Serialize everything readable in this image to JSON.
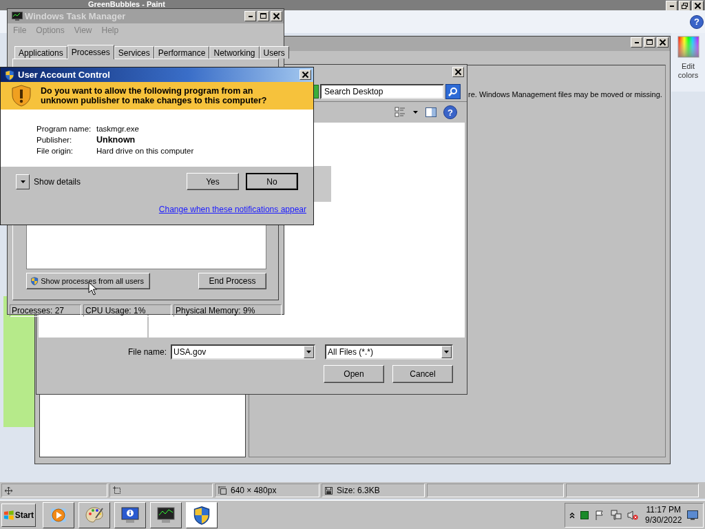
{
  "paint": {
    "title": "GreenBubbles - Paint",
    "help": "?",
    "edit_colors": "Edit colors",
    "status_cells": [
      {
        "kind": "move"
      },
      {
        "kind": "selection"
      },
      {
        "kind": "dimensions",
        "text": "640 × 480px"
      },
      {
        "kind": "size",
        "text": "Size: 6.3KB"
      },
      {
        "kind": "empty"
      },
      {
        "kind": "empty"
      }
    ]
  },
  "error_window": {
    "message": "re. Windows Management files may be moved or missing."
  },
  "open_dialog": {
    "search": {
      "placeholder": "Search Desktop"
    },
    "help": "?",
    "file_name_label": "File name:",
    "file_name": "USA.gov",
    "file_type": "All Files (*.*)",
    "buttons": [
      "Open",
      "Cancel"
    ]
  },
  "task_manager": {
    "title": "Windows Task Manager",
    "menu": [
      "File",
      "Options",
      "View",
      "Help"
    ],
    "tabs": [
      {
        "label": "Applications",
        "selected": false
      },
      {
        "label": "Processes",
        "selected": true
      },
      {
        "label": "Services",
        "selected": false
      },
      {
        "label": "Performance",
        "selected": false
      },
      {
        "label": "Networking",
        "selected": false
      },
      {
        "label": "Users",
        "selected": false
      }
    ],
    "buttons": [
      {
        "label": "Show processes from all users",
        "shield": true
      },
      {
        "label": "End Process",
        "shield": false
      }
    ],
    "status_bar": [
      "Processes: 27",
      "CPU Usage: 1%",
      "Physical Memory: 9%"
    ]
  },
  "uac": {
    "title": "User Account Control",
    "question": "Do you want to allow the following program from an unknown publisher to make changes to this computer?",
    "details": [
      {
        "label": "Program name:",
        "value": "taskmgr.exe",
        "bold": false
      },
      {
        "label": "Publisher:",
        "value": "Unknown",
        "bold": true
      },
      {
        "label": "File origin:",
        "value": "Hard drive on this computer",
        "bold": false
      }
    ],
    "show_details": "Show details",
    "buttons": [
      "Yes",
      "No"
    ],
    "link": "Change when these notifications appear"
  },
  "taskbar": {
    "start": "Start",
    "apps": [
      {
        "selected": false
      },
      {
        "selected": false
      },
      {
        "selected": false
      },
      {
        "selected": false
      },
      {
        "selected": true
      }
    ],
    "time": "11:17 PM",
    "date": "9/30/2022"
  }
}
